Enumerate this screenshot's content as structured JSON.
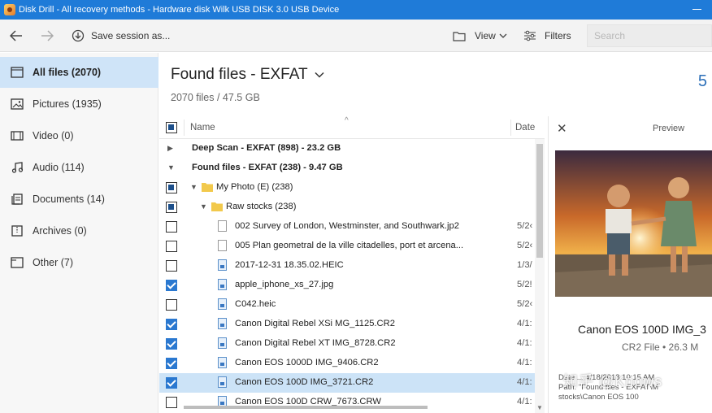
{
  "window": {
    "title": "Disk Drill - All recovery methods - Hardware disk Wilk USB DISK 3.0 USB Device"
  },
  "toolbar": {
    "back_icon": "arrow-left-icon",
    "forward_icon": "arrow-right-icon",
    "save_session_label": "Save session as...",
    "view_label": "View",
    "filters_label": "Filters",
    "search_placeholder": "Search"
  },
  "sidebar": {
    "items": [
      {
        "label": "All files (2070)",
        "icon": "all-files-icon",
        "active": true
      },
      {
        "label": "Pictures (1935)",
        "icon": "pictures-icon",
        "active": false
      },
      {
        "label": "Video (0)",
        "icon": "video-icon",
        "active": false
      },
      {
        "label": "Audio (114)",
        "icon": "audio-icon",
        "active": false
      },
      {
        "label": "Documents (14)",
        "icon": "documents-icon",
        "active": false
      },
      {
        "label": "Archives (0)",
        "icon": "archives-icon",
        "active": false
      },
      {
        "label": "Other (7)",
        "icon": "other-icon",
        "active": false
      }
    ]
  },
  "main": {
    "title": "Found files - EXFAT",
    "subtitle": "2070 files / 47.5 GB",
    "right_number": "5"
  },
  "list": {
    "columns": {
      "name": "Name",
      "date": "Date"
    },
    "rows": [
      {
        "type": "group",
        "expanded": false,
        "checkbox": "none",
        "name": "Deep Scan - EXFAT (898) - 23.2 GB",
        "date": ""
      },
      {
        "type": "group",
        "expanded": true,
        "checkbox": "none",
        "name": "Found files - EXFAT (238) - 9.47 GB",
        "date": ""
      },
      {
        "type": "folder",
        "expanded": true,
        "checkbox": "partial",
        "name": "My Photo (E) (238)",
        "date": ""
      },
      {
        "type": "folder",
        "expanded": true,
        "checkbox": "partial",
        "name": "Raw stocks (238)",
        "date": ""
      },
      {
        "type": "file",
        "kind": "doc",
        "checkbox": "unchecked",
        "name": "002 Survey of London, Westminster, and Southwark.jp2",
        "date": "5/2‹"
      },
      {
        "type": "file",
        "kind": "doc",
        "checkbox": "unchecked",
        "name": "005 Plan geometral de la ville citadelles, port et arcena...",
        "date": "5/2‹"
      },
      {
        "type": "file",
        "kind": "img",
        "checkbox": "unchecked",
        "name": "2017-12-31 18.35.02.HEIC",
        "date": "1/3/"
      },
      {
        "type": "file",
        "kind": "img",
        "checkbox": "checked",
        "name": "apple_iphone_xs_27.jpg",
        "date": "5/2!"
      },
      {
        "type": "file",
        "kind": "img",
        "checkbox": "unchecked",
        "name": "C042.heic",
        "date": "5/2‹"
      },
      {
        "type": "file",
        "kind": "img",
        "checkbox": "checked",
        "name": "Canon Digital Rebel XSi MG_1125.CR2",
        "date": "4/1:"
      },
      {
        "type": "file",
        "kind": "img",
        "checkbox": "checked",
        "name": "Canon Digital Rebel XT IMG_8728.CR2",
        "date": "4/1:"
      },
      {
        "type": "file",
        "kind": "img",
        "checkbox": "checked",
        "name": "Canon EOS 1000D IMG_9406.CR2",
        "date": "4/1:"
      },
      {
        "type": "file",
        "kind": "img",
        "checkbox": "checked",
        "name": "Canon EOS 100D IMG_3721.CR2",
        "date": "4/1:",
        "selected": true
      },
      {
        "type": "file",
        "kind": "img",
        "checkbox": "unchecked",
        "name": "Canon EOS 100D CRW_7673.CRW",
        "date": "4/1:"
      }
    ]
  },
  "preview": {
    "title": "Preview",
    "close_icon": "close-icon",
    "file_name": "Canon EOS 100D IMG_3",
    "file_meta": "CR2 File • 26.3 M",
    "date_line": "Date ... 4/18/2018 10:15 AM",
    "path_line1": "Path: \"Found files - EXFAT\\M",
    "path_line2": "stocks\\Canon EOS 100",
    "watermark": "知乎 @Knows"
  },
  "colors": {
    "titlebar": "#1f7bd8",
    "accent": "#2a78d0",
    "sidebar_active": "#cfe4f8",
    "selected_row": "#cce3f7"
  }
}
